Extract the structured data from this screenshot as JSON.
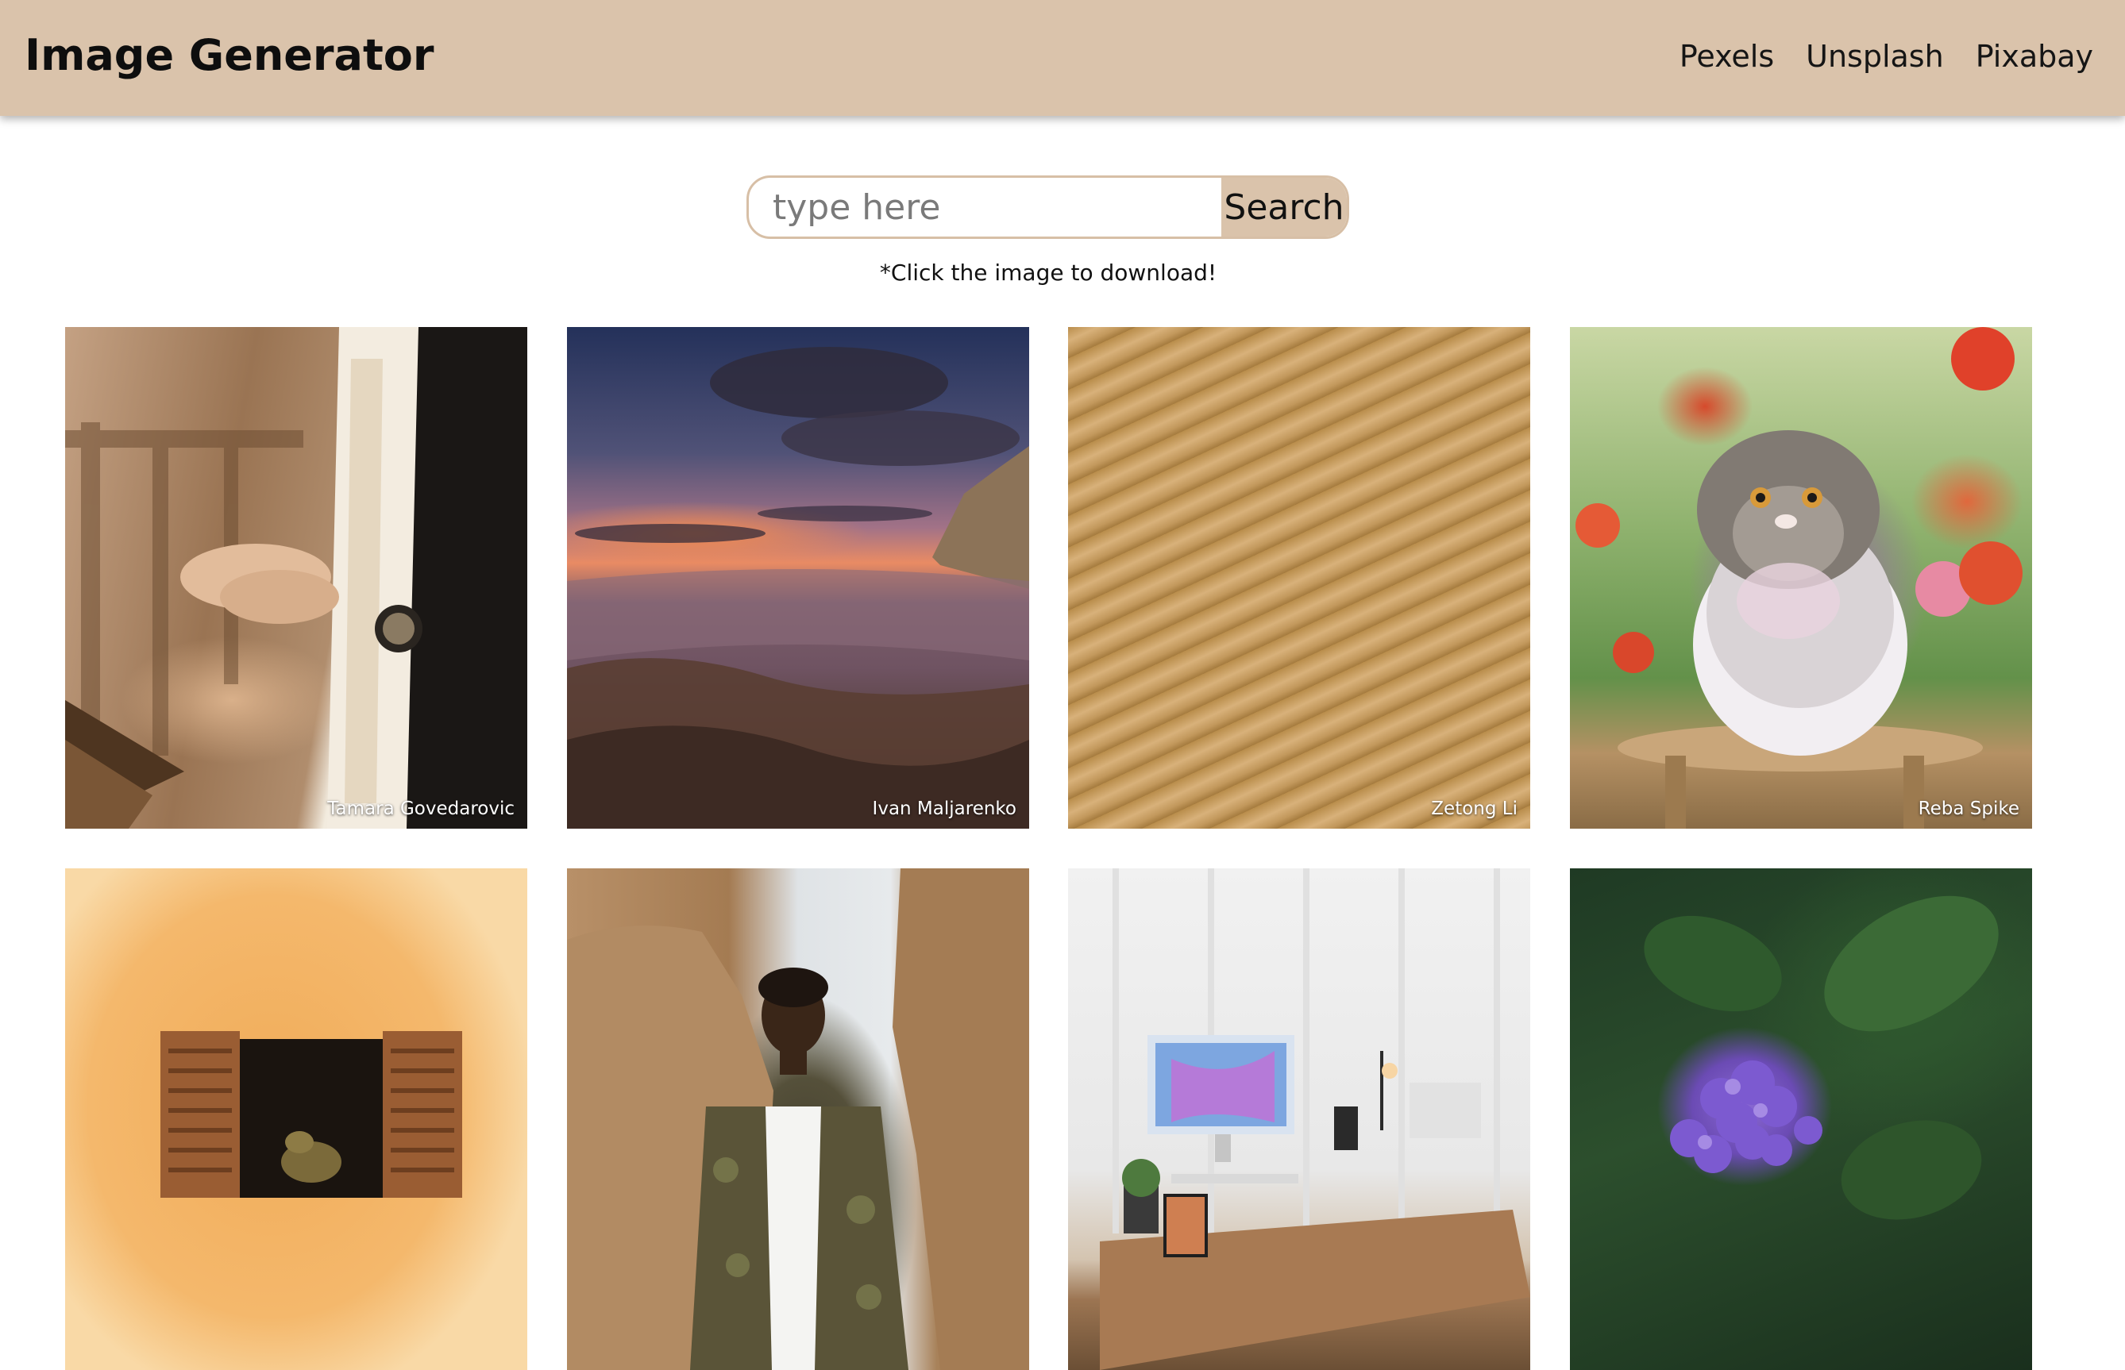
{
  "header": {
    "title": "Image Generator",
    "nav": [
      "Pexels",
      "Unsplash",
      "Pixabay"
    ]
  },
  "search": {
    "placeholder": "type here",
    "value": "",
    "button_label": "Search"
  },
  "hint": "*Click the image to download!",
  "gallery": [
    {
      "subject": "priest-hands",
      "credit": "Tamara Govedarovic"
    },
    {
      "subject": "coastal-sunset",
      "credit": "Ivan Maljarenko"
    },
    {
      "subject": "sand-dunes",
      "credit": "Zetong Li"
    },
    {
      "subject": "persian-cat",
      "credit": "Reba Spike"
    },
    {
      "subject": "orange-wall-window",
      "credit": ""
    },
    {
      "subject": "man-rocky-coast",
      "credit": ""
    },
    {
      "subject": "desk-setup",
      "credit": ""
    },
    {
      "subject": "lilac-flower",
      "credit": ""
    }
  ],
  "colors": {
    "header_bg": "#dac3ab",
    "search_border": "#d7bfa6",
    "button_bg": "#dac3ab",
    "text": "#111111"
  }
}
